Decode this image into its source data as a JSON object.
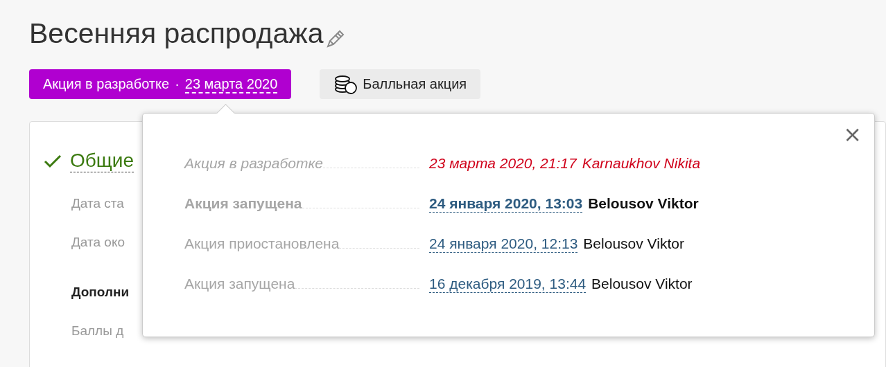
{
  "title": "Весенняя распродажа",
  "status_badge": {
    "label": "Акция в разработке",
    "separator": "·",
    "date": "23 марта 2020"
  },
  "type_badge": {
    "label": "Балльная акция"
  },
  "card": {
    "section": {
      "label": "Общие",
      "checked": true
    },
    "items": [
      {
        "kind": "field",
        "text": "Дата ста"
      },
      {
        "kind": "field",
        "text": "Дата око"
      },
      {
        "kind": "heading",
        "text": "Дополни"
      },
      {
        "kind": "field",
        "text": "Баллы д"
      }
    ]
  },
  "history": [
    {
      "kind": "draft",
      "status": "Акция в разработке",
      "date": "23 марта 2020, 21:17",
      "author": "Karnaukhov Nikita"
    },
    {
      "kind": "current",
      "status": "Акция запущена",
      "date": "24 января 2020, 13:03",
      "author": "Belousov Viktor"
    },
    {
      "kind": "past",
      "status": "Акция приостановлена",
      "date": "24 января 2020, 12:13",
      "author": "Belousov Viktor"
    },
    {
      "kind": "past",
      "status": "Акция запущена",
      "date": "16 декабря 2019, 13:44",
      "author": "Belousov Viktor"
    }
  ],
  "close": "×"
}
